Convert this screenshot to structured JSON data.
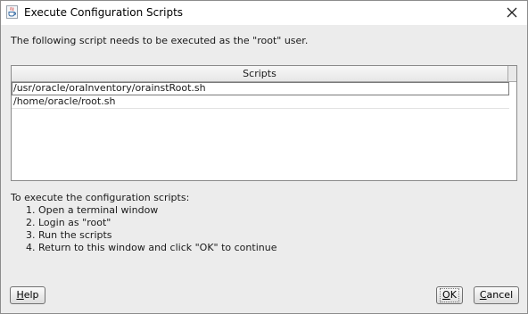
{
  "window": {
    "title": "Execute Configuration Scripts",
    "icon": "java-cup-icon",
    "close_icon": "close-icon"
  },
  "intro_text": "The following script needs to be executed as the \"root\" user.",
  "scripts_table": {
    "header": "Scripts",
    "rows": [
      "/usr/oracle/oraInventory/orainstRoot.sh",
      "/home/oracle/root.sh"
    ],
    "selected_index": 0
  },
  "instructions": {
    "heading": "To execute the configuration scripts:",
    "steps": [
      {
        "num": "1.",
        "text": "Open a terminal window"
      },
      {
        "num": "2.",
        "text": "Login as \"root\""
      },
      {
        "num": "3.",
        "text": "Run the scripts"
      },
      {
        "num": "4.",
        "text": "Return to this window and click \"OK\" to continue"
      }
    ]
  },
  "buttons": {
    "help_label": "Help",
    "ok_label": "OK",
    "cancel_label": "Cancel"
  }
}
